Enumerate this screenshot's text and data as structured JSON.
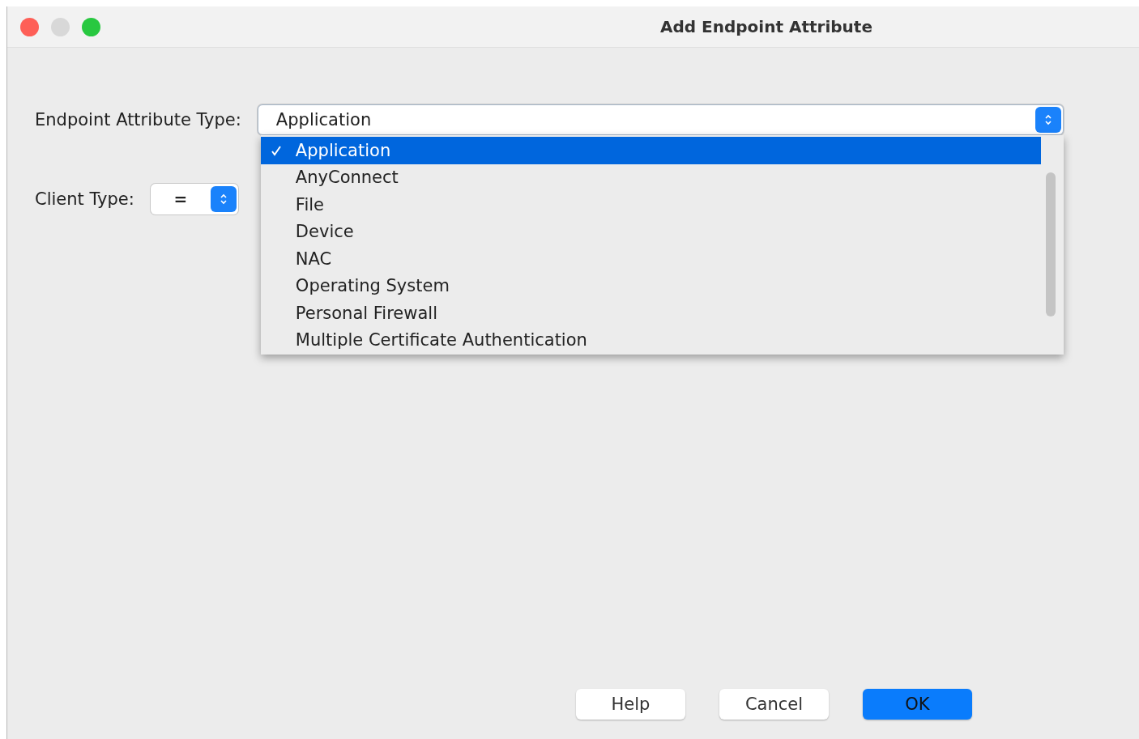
{
  "window": {
    "title": "Add Endpoint Attribute"
  },
  "attribute_type": {
    "label": "Endpoint Attribute Type:",
    "value": "Application",
    "menu": {
      "open": true,
      "items": [
        {
          "label": "Application",
          "selected": true
        },
        {
          "label": "AnyConnect",
          "selected": false
        },
        {
          "label": "File",
          "selected": false
        },
        {
          "label": "Device",
          "selected": false
        },
        {
          "label": "NAC",
          "selected": false
        },
        {
          "label": "Operating System",
          "selected": false
        },
        {
          "label": "Personal Firewall",
          "selected": false
        },
        {
          "label": "Multiple Certificate Authentication",
          "selected": false
        }
      ]
    }
  },
  "client_type": {
    "label": "Client Type:",
    "operator": "="
  },
  "buttons": [
    {
      "label": "Help",
      "kind": "normal"
    },
    {
      "label": "Cancel",
      "kind": "normal"
    },
    {
      "label": "OK",
      "kind": "default"
    }
  ]
}
